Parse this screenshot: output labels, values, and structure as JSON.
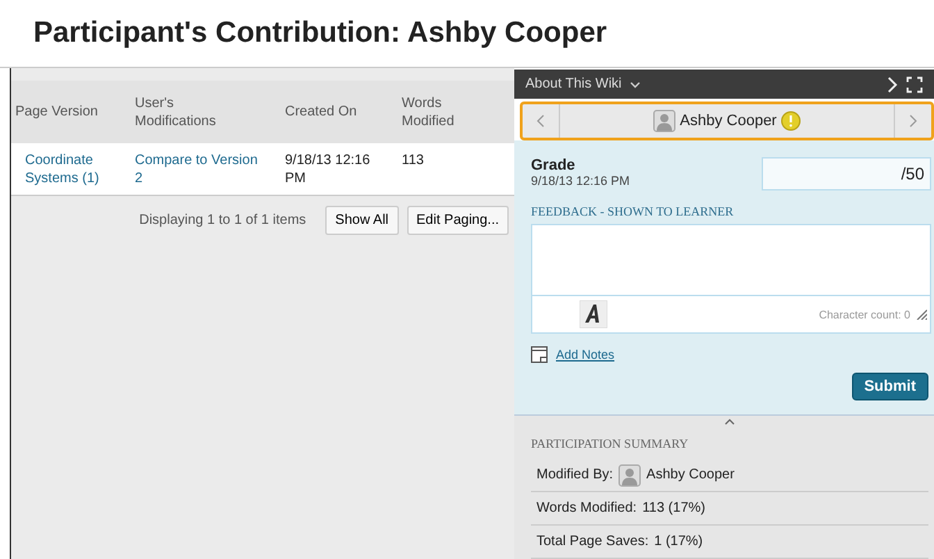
{
  "page_title": "Participant's Contribution: Ashby Cooper",
  "table": {
    "columns": [
      "Page Version",
      "User's Modifications",
      "Created On",
      "Words Modified"
    ],
    "rows": [
      {
        "cells": [
          "Coordinate Systems (1)",
          "Compare to Version 2",
          "9/18/13 12:16 PM",
          "113"
        ]
      }
    ]
  },
  "paging": {
    "text": "Displaying 1 to 1 of 1 items",
    "buttons": [
      "Show All",
      "Edit Paging..."
    ]
  },
  "panel": {
    "title": "About This Wiki",
    "user": "Ashby Cooper",
    "needs_grading": true,
    "grade": {
      "label": "Grade",
      "date": "9/18/13 12:16 PM",
      "suffix": "/50"
    },
    "feedback": {
      "heading": "FEEDBACK - SHOWN TO LEARNER",
      "char_count": "Character count: 0"
    },
    "add_notes": "Add Notes",
    "submit": "Submit",
    "summary": {
      "heading": "PARTICIPATION SUMMARY",
      "items": [
        {
          "label": "Modified By:",
          "value": "Ashby Cooper",
          "avatar": true
        },
        {
          "label": "Words Modified:",
          "value": "113 (17%)",
          "avatar": false
        },
        {
          "label": "Total Page Saves:",
          "value": "1 (17%)",
          "avatar": false
        }
      ]
    }
  }
}
